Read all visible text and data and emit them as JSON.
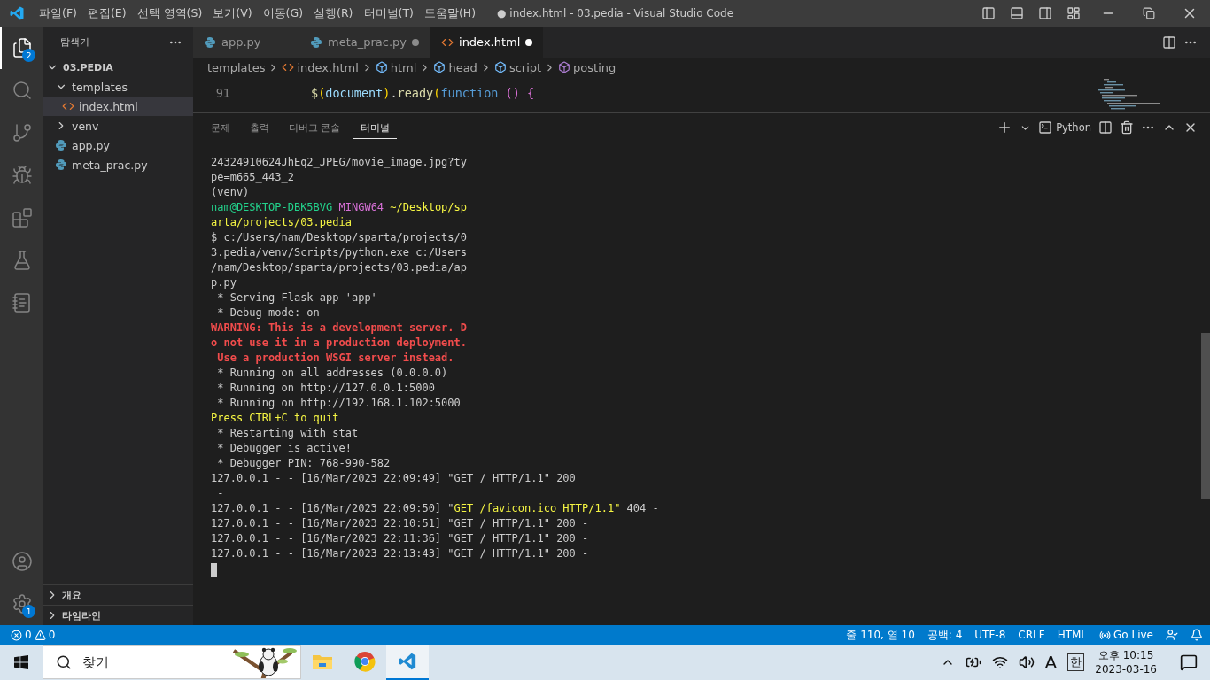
{
  "window": {
    "title": "● index.html - 03.pedia - Visual Studio Code"
  },
  "menu": [
    "파일(F)",
    "편집(E)",
    "선택 영역(S)",
    "보기(V)",
    "이동(G)",
    "실행(R)",
    "터미널(T)",
    "도움말(H)"
  ],
  "activity_bar": {
    "items": [
      {
        "kind": "files",
        "selected": true,
        "badge": "2"
      },
      {
        "kind": "search",
        "selected": false
      },
      {
        "kind": "git",
        "selected": false
      },
      {
        "kind": "debug",
        "selected": false
      },
      {
        "kind": "extensions",
        "selected": false
      },
      {
        "kind": "testing",
        "selected": false
      },
      {
        "kind": "notebook",
        "selected": false
      }
    ],
    "bottom": [
      {
        "kind": "account"
      },
      {
        "kind": "settings",
        "badge": "1"
      }
    ]
  },
  "sidebar": {
    "title": "탐색기",
    "root": {
      "label": "03.PEDIA",
      "expanded": true,
      "children": [
        {
          "label": "templates",
          "kind": "folder",
          "expanded": true,
          "selected": false,
          "children": [
            {
              "label": "index.html",
              "kind": "html",
              "selected": true
            }
          ]
        },
        {
          "label": "venv",
          "kind": "folder",
          "expanded": false,
          "selected": false
        },
        {
          "label": "app.py",
          "kind": "python",
          "selected": false
        },
        {
          "label": "meta_prac.py",
          "kind": "python",
          "selected": false
        }
      ]
    },
    "sections": [
      {
        "label": "개요",
        "expanded": false
      },
      {
        "label": "타임라인",
        "expanded": false
      }
    ]
  },
  "tabs": [
    {
      "label": "app.py",
      "kind": "python",
      "selected": false,
      "modified": false
    },
    {
      "label": "meta_prac.py",
      "kind": "python",
      "selected": false,
      "modified": true
    },
    {
      "label": "index.html",
      "kind": "html",
      "selected": true,
      "modified": true
    }
  ],
  "breadcrumb": [
    {
      "label": "templates",
      "kind": "folder"
    },
    {
      "label": "index.html",
      "kind": "html"
    },
    {
      "label": "html",
      "kind": "element"
    },
    {
      "label": "head",
      "kind": "element"
    },
    {
      "label": "script",
      "kind": "element"
    },
    {
      "label": "posting",
      "kind": "method"
    }
  ],
  "code": [
    {
      "number": "91",
      "tokens": [
        {
          "text": "        $",
          "kind": "func"
        },
        {
          "text": "(",
          "kind": "bracket1"
        },
        {
          "text": "document",
          "kind": "var"
        },
        {
          "text": ")",
          "kind": "bracket1"
        },
        {
          "text": ".",
          "kind": "plain"
        },
        {
          "text": "ready",
          "kind": "func"
        },
        {
          "text": "(",
          "kind": "bracket1"
        },
        {
          "text": "function",
          "kind": "keyword"
        },
        {
          "text": " ()",
          "kind": "bracket2"
        },
        {
          "text": " {",
          "kind": "bracket2"
        }
      ]
    }
  ],
  "panel": {
    "tabs": [
      {
        "label": "문제",
        "selected": false
      },
      {
        "label": "출력",
        "selected": false
      },
      {
        "label": "디버그 콘솔",
        "selected": false
      },
      {
        "label": "터미널",
        "selected": true
      }
    ],
    "terminal_name": "Python",
    "lines": [
      [
        {
          "text": "24324910624JhEq2_JPEG/movie_image.jpg?ty",
          "kind": "plain"
        }
      ],
      [
        {
          "text": "pe=m665_443_2",
          "kind": "plain"
        }
      ],
      [
        {
          "text": "(venv)",
          "kind": "plain"
        }
      ],
      [
        {
          "text": "nam@DESKTOP-DBK5BVG",
          "kind": "user"
        },
        {
          "text": " MINGW64",
          "kind": "shell"
        },
        {
          "text": " ~/Desktop/sp",
          "kind": "path"
        }
      ],
      [
        {
          "text": "arta/projects/03.pedia",
          "kind": "path"
        }
      ],
      [
        {
          "text": "$ c:/Users/nam/Desktop/sparta/projects/0",
          "kind": "plain"
        }
      ],
      [
        {
          "text": "3.pedia/venv/Scripts/python.exe c:/Users",
          "kind": "plain"
        }
      ],
      [
        {
          "text": "/nam/Desktop/sparta/projects/03.pedia/ap",
          "kind": "plain"
        }
      ],
      [
        {
          "text": "p.py",
          "kind": "plain"
        }
      ],
      [
        {
          "text": " * Serving Flask app 'app'",
          "kind": "plain"
        }
      ],
      [
        {
          "text": " * Debug mode: on",
          "kind": "plain"
        }
      ],
      [
        {
          "text": "WARNING: This is a development server. D",
          "kind": "warning"
        }
      ],
      [
        {
          "text": "o not use it in a production deployment.",
          "kind": "warning"
        }
      ],
      [
        {
          "text": " Use a production WSGI server instead.",
          "kind": "warning"
        }
      ],
      [
        {
          "text": " * Running on all addresses (0.0.0.0)",
          "kind": "plain"
        }
      ],
      [
        {
          "text": " * Running on http://127.0.0.1:5000",
          "kind": "plain"
        }
      ],
      [
        {
          "text": " * Running on http://192.168.1.102:5000",
          "kind": "plain"
        }
      ],
      [
        {
          "text": "Press CTRL+C to quit",
          "kind": "notice"
        }
      ],
      [
        {
          "text": " * Restarting with stat",
          "kind": "plain"
        }
      ],
      [
        {
          "text": " * Debugger is active!",
          "kind": "plain"
        }
      ],
      [
        {
          "text": " * Debugger PIN: 768-990-582",
          "kind": "plain"
        }
      ],
      [
        {
          "text": "127.0.0.1 - - [16/Mar/2023 22:09:49] \"GET / HTTP/1.1\" 200",
          "kind": "plain"
        }
      ],
      [
        {
          "text": " -",
          "kind": "plain"
        }
      ],
      [
        {
          "text": "127.0.0.1 - - [16/Mar/2023 22:09:50] \"",
          "kind": "plain"
        },
        {
          "text": "GET /favicon.ico HTTP/1.1\"",
          "kind": "notice"
        },
        {
          "text": " 404 -",
          "kind": "plain"
        }
      ],
      [
        {
          "text": "127.0.0.1 - - [16/Mar/2023 22:10:51] \"GET / HTTP/1.1\" 200 -",
          "kind": "plain"
        }
      ],
      [
        {
          "text": "127.0.0.1 - - [16/Mar/2023 22:11:36] \"GET / HTTP/1.1\" 200 -",
          "kind": "plain"
        }
      ],
      [
        {
          "text": "127.0.0.1 - - [16/Mar/2023 22:13:43] \"GET / HTTP/1.1\" 200 -",
          "kind": "plain"
        }
      ]
    ]
  },
  "status_bar": {
    "errors": "0",
    "warnings": "0",
    "items": [
      {
        "label": "줄 110, 열 10",
        "kind": "text"
      },
      {
        "label": "공백: 4",
        "kind": "text"
      },
      {
        "label": "UTF-8",
        "kind": "text"
      },
      {
        "label": "CRLF",
        "kind": "text"
      },
      {
        "label": "HTML",
        "kind": "text"
      },
      {
        "label": "Go Live",
        "kind": "live"
      }
    ]
  },
  "taskbar": {
    "search": {
      "placeholder": "찾기"
    },
    "apps": [
      {
        "kind": "folder",
        "selected": false
      },
      {
        "kind": "browser",
        "selected": false
      },
      {
        "kind": "vscode",
        "selected": true
      }
    ],
    "tray": {
      "input_mode": "A",
      "ime": "한",
      "time": "오후 10:15",
      "date": "2023-03-16"
    }
  }
}
